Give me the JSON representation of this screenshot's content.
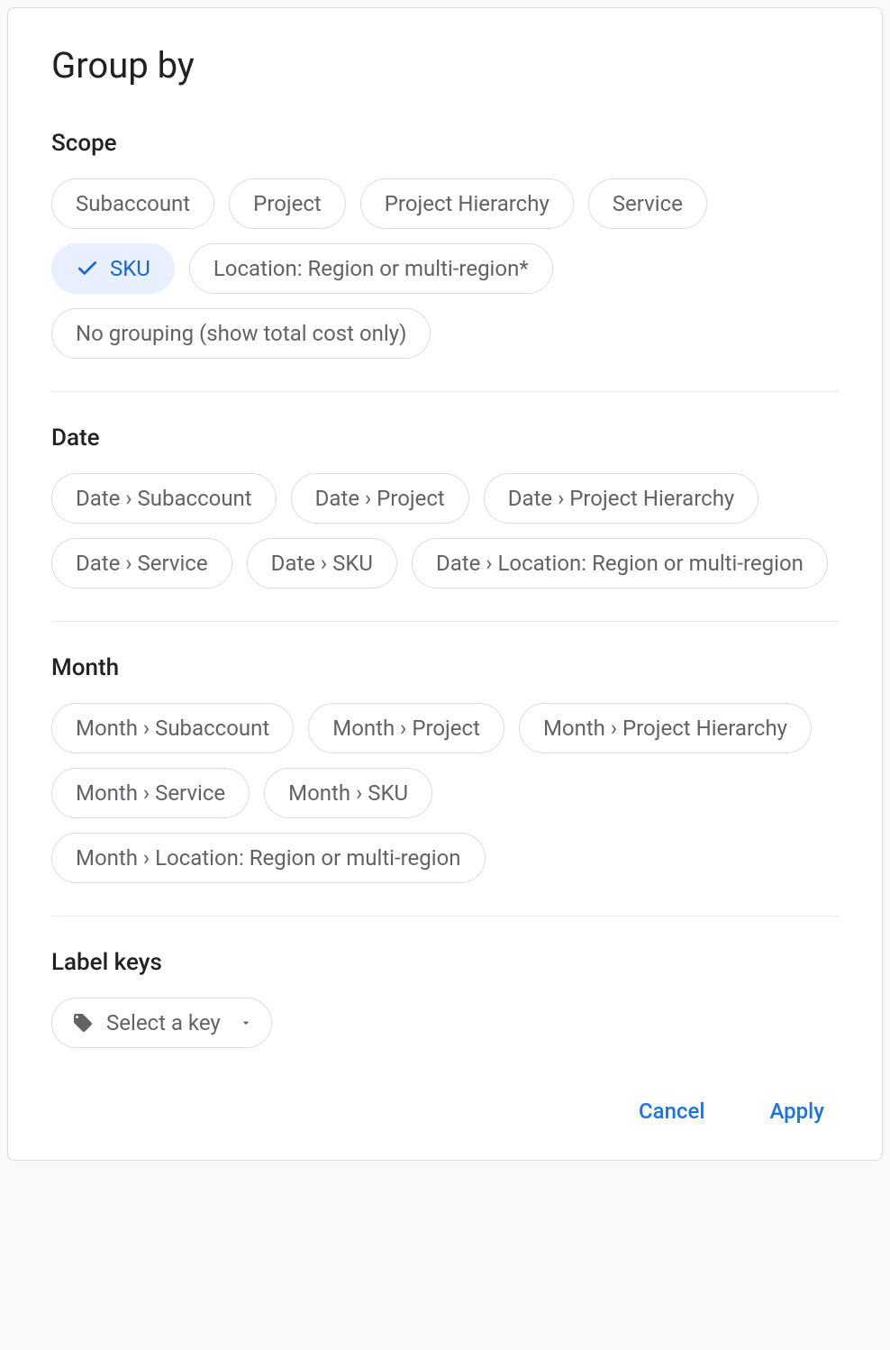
{
  "title": "Group by",
  "sections": {
    "scope": {
      "header": "Scope",
      "chips": [
        {
          "label": "Subaccount",
          "selected": false
        },
        {
          "label": "Project",
          "selected": false
        },
        {
          "label": "Project Hierarchy",
          "selected": false
        },
        {
          "label": "Service",
          "selected": false
        },
        {
          "label": "SKU",
          "selected": true
        },
        {
          "label": "Location: Region or multi-region*",
          "selected": false
        },
        {
          "label": "No grouping (show total cost only)",
          "selected": false
        }
      ]
    },
    "date": {
      "header": "Date",
      "chips": [
        {
          "label": "Date › Subaccount",
          "selected": false
        },
        {
          "label": "Date › Project",
          "selected": false
        },
        {
          "label": "Date › Project Hierarchy",
          "selected": false
        },
        {
          "label": "Date › Service",
          "selected": false
        },
        {
          "label": "Date › SKU",
          "selected": false
        },
        {
          "label": "Date › Location: Region or multi-region",
          "selected": false
        }
      ]
    },
    "month": {
      "header": "Month",
      "chips": [
        {
          "label": "Month › Subaccount",
          "selected": false
        },
        {
          "label": "Month › Project",
          "selected": false
        },
        {
          "label": "Month › Project Hierarchy",
          "selected": false
        },
        {
          "label": "Month › Service",
          "selected": false
        },
        {
          "label": "Month › SKU",
          "selected": false
        },
        {
          "label": "Month › Location: Region or multi-region",
          "selected": false
        }
      ]
    },
    "labelKeys": {
      "header": "Label keys",
      "selectLabel": "Select a key"
    }
  },
  "actions": {
    "cancel": "Cancel",
    "apply": "Apply"
  }
}
